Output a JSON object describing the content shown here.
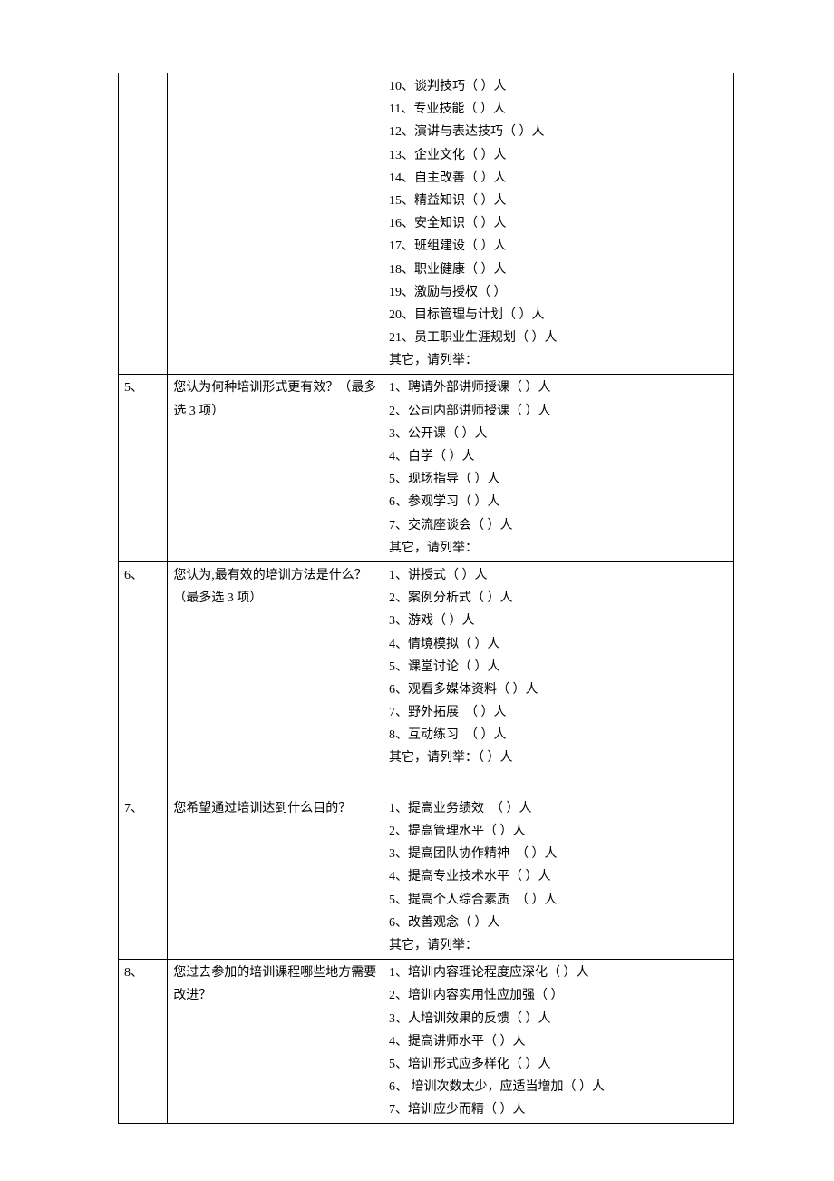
{
  "rows": [
    {
      "num": "",
      "question": "",
      "options": [
        "10、谈判技巧（ ）人",
        "11、专业技能（ ）人",
        "12、演讲与表达技巧（ ）人",
        "13、企业文化（ ）人",
        "14、自主改善（ ）人",
        "15、精益知识（ ）人",
        "16、安全知识（ ）人",
        "17、班组建设（ ）人",
        "18、职业健康（ ）人",
        "19、激励与授权（ ）",
        "20、目标管理与计划（ ）人",
        "21、员工职业生涯规划（ ）人",
        "其它，请列举："
      ]
    },
    {
      "num": "5、",
      "question": "您认为何种培训形式更有效？（最多选 3 项）",
      "options": [
        "1、聘请外部讲师授课（ ）人",
        "2、公司内部讲师授课（ ）人",
        "3、公开课（ ）人",
        "4、自学（ ）人",
        "5、现场指导（ ）人",
        "6、参观学习（ ）人",
        "7、交流座谈会（ ）人",
        "其它，请列举："
      ]
    },
    {
      "num": "6、",
      "question": "您认为,最有效的培训方法是什么？（最多选 3 项）",
      "options": [
        "1、讲授式（ ）人",
        "2、案例分析式（ ）人",
        "3、游戏（ ）人",
        "4、情境模拟（ ）人",
        "5、课堂讨论（ ）人",
        "6、观看多媒体资料（ ）人",
        "7、野外拓展　（ ）人",
        "8、互动练习　（ ）人",
        "其它，请列举：（ ）人",
        ""
      ]
    },
    {
      "num": "7、",
      "question": "您希望通过培训达到什么目的？",
      "options": [
        "1、提高业务绩效　（ ）人",
        "2、提高管理水平（ ）人",
        "3、提高团队协作精神　（ ）人",
        "4、提高专业技术水平（ ）人",
        "5、提高个人综合素质　（ ）人",
        "6、改善观念（ ）人",
        "其它，请列举："
      ]
    },
    {
      "num": "8、",
      "question": "您过去参加的培训课程哪些地方需要改进？",
      "options": [
        "1、培训内容理论程度应深化（ ）人",
        "2、培训内容实用性应加强（ ）",
        "3、人培训效果的反馈（ ）人",
        "4、提高讲师水平（ ）人",
        "5、培训形式应多样化（ ）人",
        "6、 培训次数太少，应适当增加（ ）人",
        "7、培训应少而精（ ）人"
      ]
    }
  ]
}
